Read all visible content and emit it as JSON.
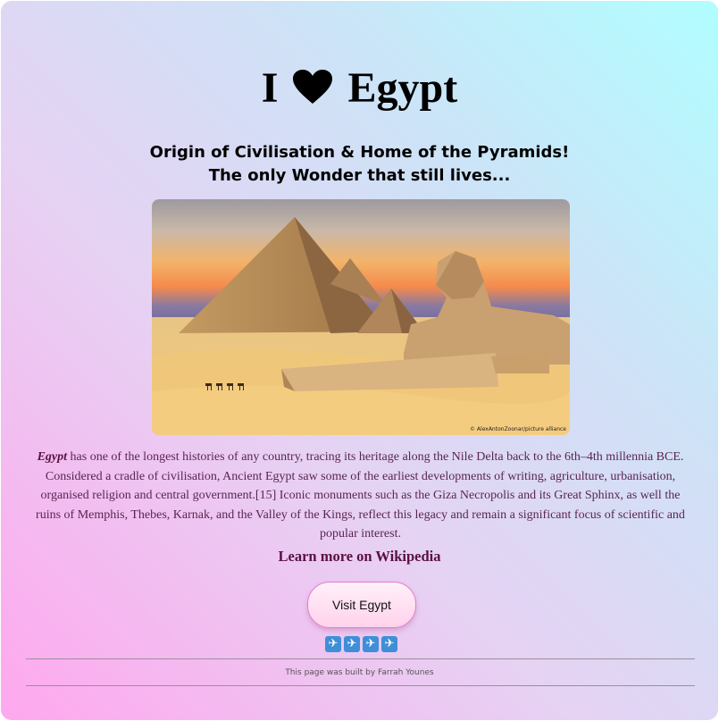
{
  "title": {
    "before": "I",
    "after": "Egypt",
    "icon": "heart-icon"
  },
  "subtitle": {
    "line1": "Origin of Civilisation & Home of the Pyramids!",
    "line2": "The only Wonder that still lives..."
  },
  "hero_image": {
    "icon": "pyramids-sphinx-photo",
    "credit": "© AlexAntonZoonar/picture alliance"
  },
  "description": {
    "lead": "Egypt",
    "text": " has one of the longest histories of any country, tracing its heritage along the Nile Delta back to the 6th–4th millennia BCE. Considered a cradle of civilisation, Ancient Egypt saw some of the earliest developments of writing, agriculture, urbanisation, organised religion and central government.[15] Iconic monuments such as the Giza Necropolis and its Great Sphinx, as well the ruins of Memphis, Thebes, Karnak, and the Valley of the Kings, reflect this legacy and remain a significant focus of scientific and popular interest."
  },
  "wiki_link": "Learn more on Wikipedia",
  "visit_button": "Visit Egypt",
  "planes": [
    "✈",
    "✈",
    "✈",
    "✈"
  ],
  "footer": "This page was built by Farrah Younes",
  "colors": {
    "gradient_pink": "#ffa8ee",
    "gradient_cyan": "#b0feff",
    "text_plum": "#5a2550"
  }
}
